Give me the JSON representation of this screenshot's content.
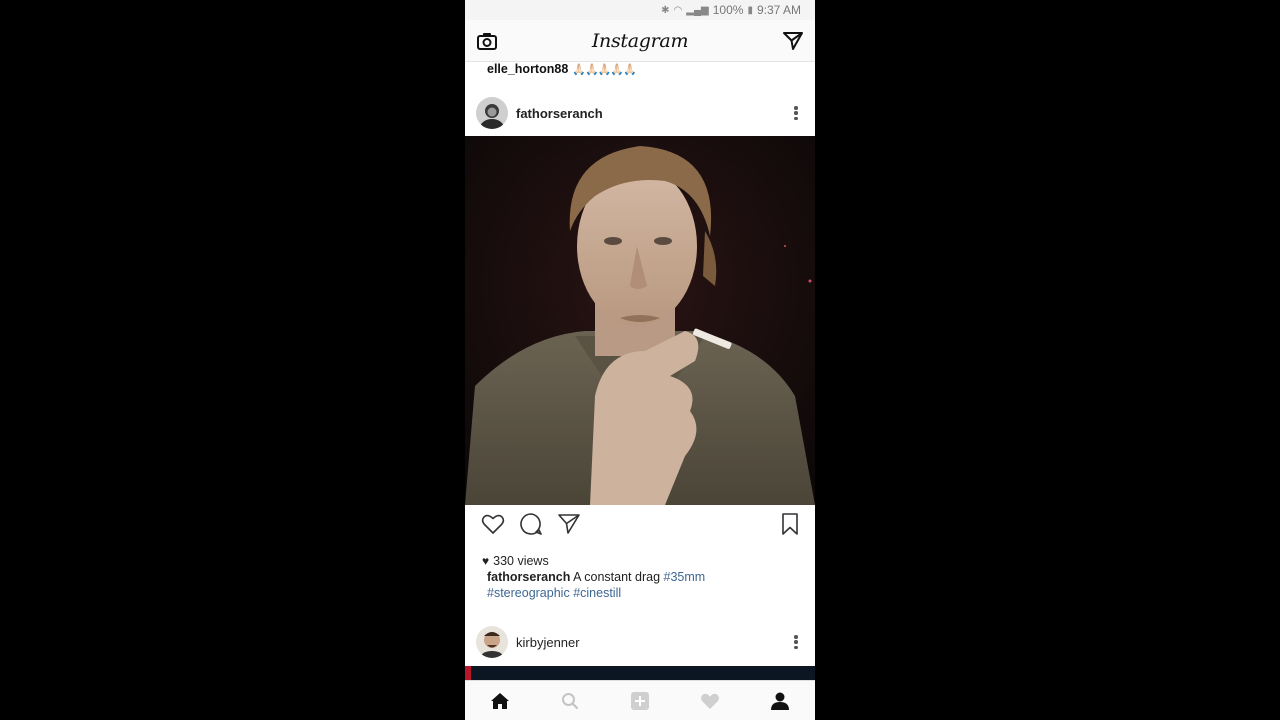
{
  "status_bar": {
    "battery": "100%",
    "time": "9:37 AM"
  },
  "header": {
    "logo_text": "Instagram",
    "camera_icon": "camera-icon",
    "direct_icon": "paper-plane-icon"
  },
  "previous_post": {
    "username": "elle_horton88",
    "caption_emoji": "🙏🏻🙏🏻🙏🏻🙏🏻🙏🏻"
  },
  "post": {
    "username": "fathorseranch",
    "views": "330 views",
    "caption_text": "A constant drag",
    "hashtags": [
      "#35mm",
      "#stereographic",
      "#cinestill"
    ],
    "action_icons": [
      "heart-icon",
      "comment-icon",
      "share-icon",
      "bookmark-icon"
    ]
  },
  "next_post": {
    "username": "kirbyjenner"
  },
  "bottom_nav": {
    "items": [
      "home-icon",
      "search-icon",
      "add-icon",
      "activity-icon",
      "profile-icon"
    ]
  },
  "colors": {
    "hashtag": "#3d6793",
    "header_bg": "#fafafa",
    "page_bg": "#000000"
  }
}
